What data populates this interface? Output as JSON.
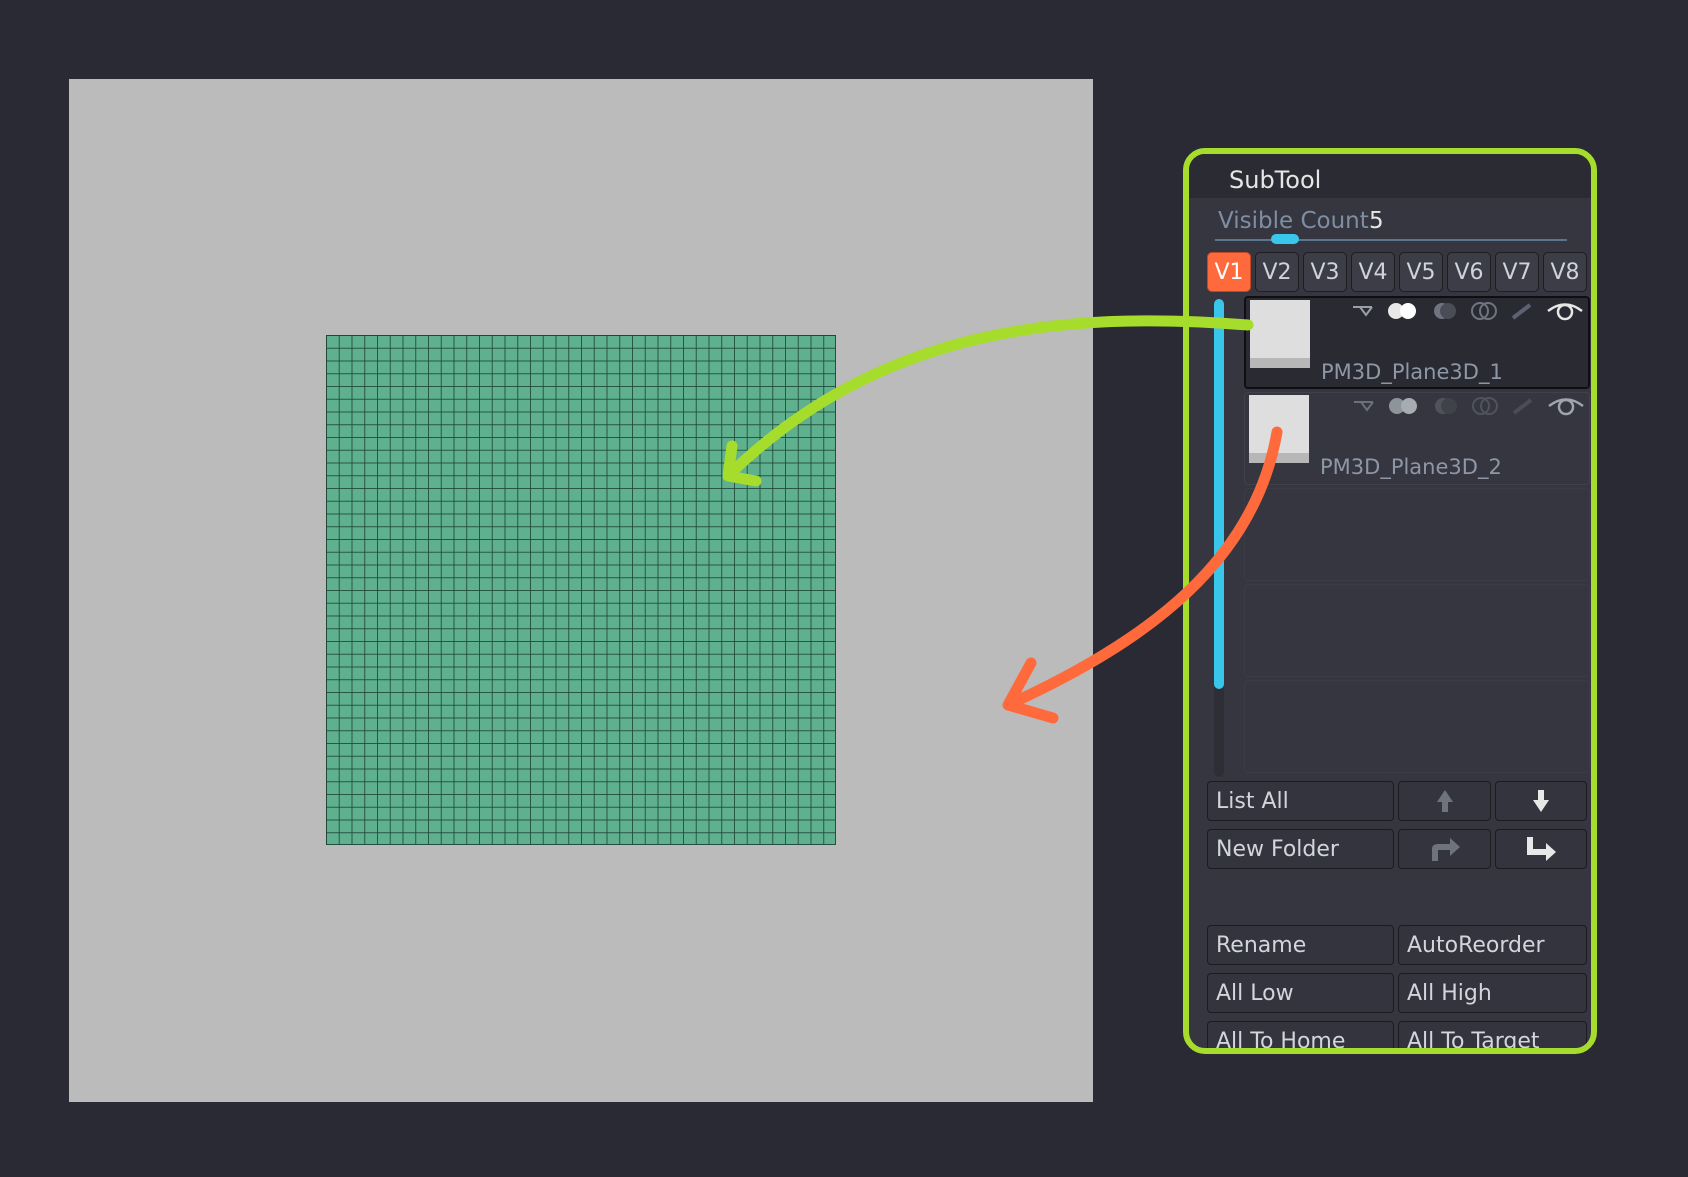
{
  "panel": {
    "title": "SubTool",
    "visible_count_label": "Visible Count",
    "visible_count_value": "5",
    "versions": [
      "V1",
      "V2",
      "V3",
      "V4",
      "V5",
      "V6",
      "V7",
      "V8"
    ],
    "active_version": "V1"
  },
  "subtools": [
    {
      "name": "PM3D_Plane3D_1",
      "selected": true
    },
    {
      "name": "PM3D_Plane3D_2",
      "selected": false
    }
  ],
  "buttons": {
    "list_all": "List All",
    "new_folder": "New Folder",
    "rename": "Rename",
    "auto_reorder": "AutoReorder",
    "all_low": "All Low",
    "all_high": "All High",
    "all_to_home": "All To Home",
    "all_to_target": "All To Target"
  },
  "colors": {
    "background": "#292a33",
    "viewport": "#bbbbbb",
    "mesh": "#5fb08f",
    "panel_highlight": "#a6dc2c",
    "active_version": "#ff6a3d",
    "accent_blue": "#38c7ea",
    "arrow_green": "#a6dc2c",
    "arrow_orange": "#ff6a3d"
  },
  "icons": [
    "merge-arrow-icon",
    "toggle-icon",
    "half-circle-icon",
    "split-circle-icon",
    "brush-icon",
    "eye-icon",
    "arrow-up-icon",
    "arrow-down-icon",
    "arrow-right-curved-icon",
    "arrow-down-right-icon"
  ]
}
